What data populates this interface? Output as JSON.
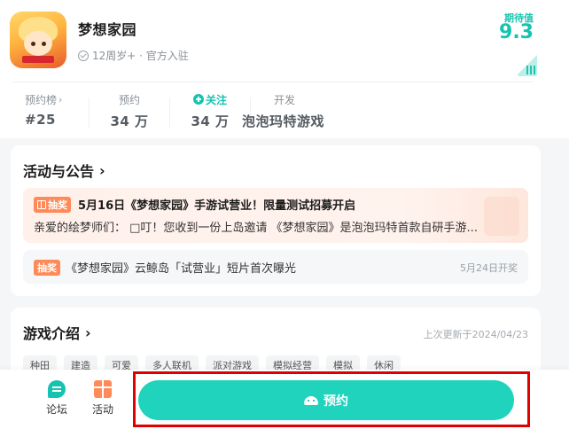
{
  "app": {
    "name": "梦想家园",
    "meta": "12周岁+ · 官方入驻",
    "score_label": "期待值",
    "score_value": "9.3"
  },
  "stats": [
    {
      "label": "预约榜",
      "value": "#25"
    },
    {
      "label": "预约",
      "value": "34 万"
    },
    {
      "label": "关注",
      "value": "34 万"
    },
    {
      "label": "开发",
      "value": "泡泡玛特游戏"
    }
  ],
  "activity": {
    "title": "活动与公告",
    "items": [
      {
        "tag": "抽奖",
        "headline": "5月16日《梦想家园》手游试营业！限量测试招募开启",
        "body": "亲爱的绘梦师们：  □叮！您收到一份上岛邀请 《梦想家园》是泡泡玛特首款自研手游..."
      },
      {
        "tag": "抽奖",
        "headline": "《梦想家园》云鲸岛「试营业」短片首次曝光",
        "date": "5月24日开奖"
      }
    ]
  },
  "intro": {
    "title": "游戏介绍",
    "updated": "上次更新于2024/04/23",
    "tags": [
      "种田",
      "建造",
      "可爱",
      "多人联机",
      "派对游戏",
      "模拟经营",
      "模拟",
      "休闲"
    ]
  },
  "bottom": {
    "forum_label": "论坛",
    "event_label": "活动",
    "reserve_label": "预约"
  },
  "colors": {
    "accent": "#1fd3bd",
    "tag": "#ff8a57",
    "highlight_frame": "#e00000"
  },
  "icons": [
    "check-circle-icon",
    "heart-plus-icon",
    "gift-icon",
    "chat-icon",
    "android-icon",
    "chevron-right-icon"
  ]
}
